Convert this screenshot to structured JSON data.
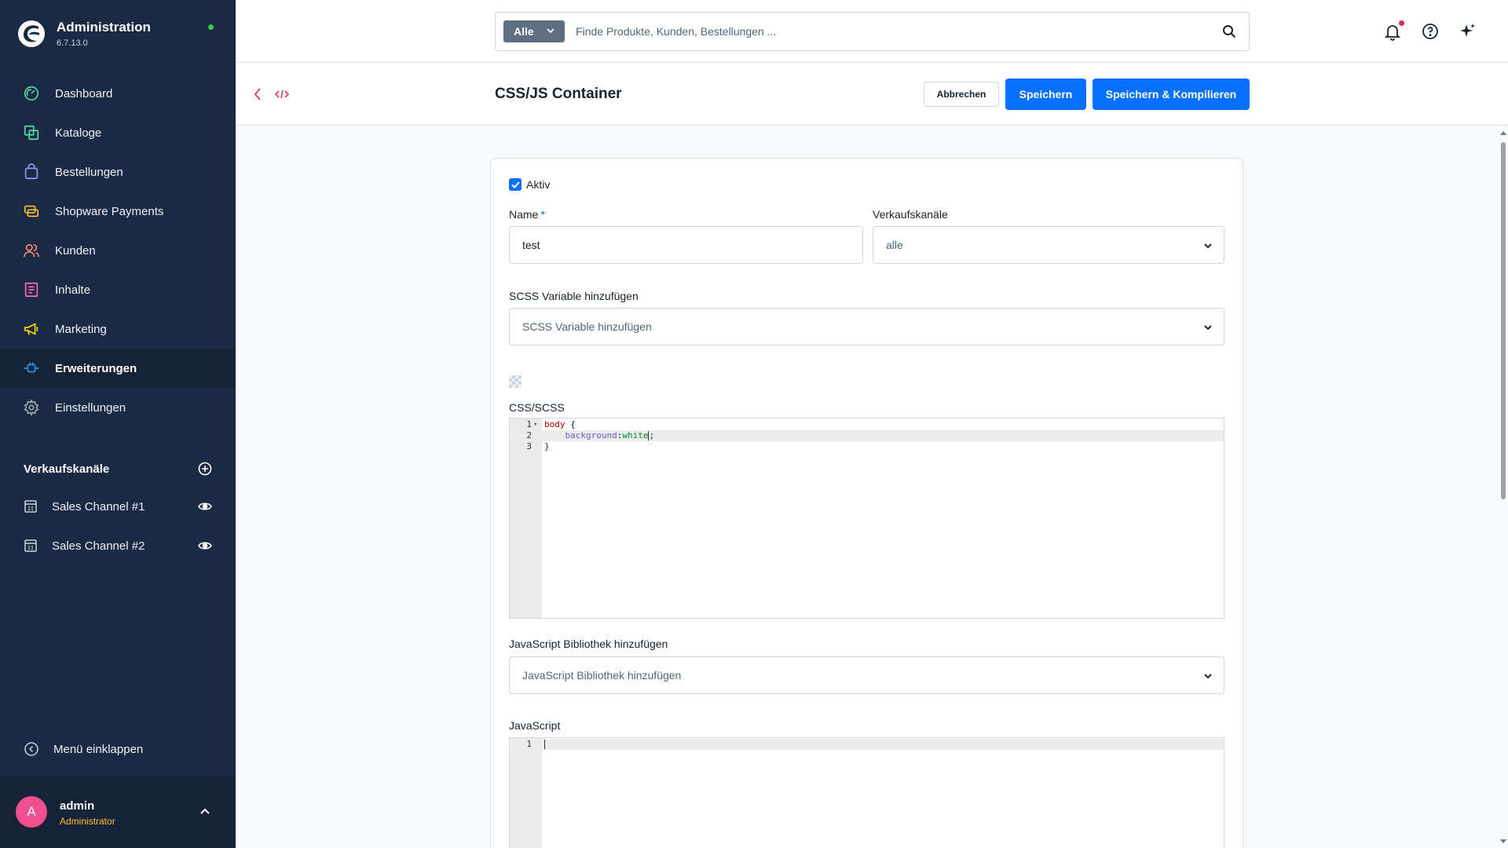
{
  "app": {
    "title": "Administration",
    "version": "6.7.13.0",
    "status_color": "#37d046"
  },
  "sidebar": {
    "items": [
      {
        "label": "Dashboard",
        "icon": "gauge-icon",
        "color": "#57d9a3"
      },
      {
        "label": "Kataloge",
        "icon": "products-icon",
        "color": "#57d9a3"
      },
      {
        "label": "Bestellungen",
        "icon": "shopping-bag-icon",
        "color": "#a092f0"
      },
      {
        "label": "Shopware Payments",
        "icon": "payment-icon",
        "color": "#ffc22c"
      },
      {
        "label": "Kunden",
        "icon": "users-icon",
        "color": "#f88962"
      },
      {
        "label": "Inhalte",
        "icon": "content-icon",
        "color": "#ff68b4"
      },
      {
        "label": "Marketing",
        "icon": "megaphone-icon",
        "color": "#ffd700"
      },
      {
        "label": "Erweiterungen",
        "icon": "plug-icon",
        "color": "#189eff",
        "active": true
      },
      {
        "label": "Einstellungen",
        "icon": "gear-icon",
        "color": "#9aa8b5"
      }
    ],
    "sales_channels_title": "Verkaufskanäle",
    "sales_channels": [
      {
        "label": "Sales Channel #1"
      },
      {
        "label": "Sales Channel #2"
      }
    ],
    "collapse_label": "Menü einklappen",
    "user": {
      "initial": "A",
      "name": "admin",
      "role": "Administrator"
    }
  },
  "topbar": {
    "search_filter": "Alle",
    "search_placeholder": "Finde Produkte, Kunden, Bestellungen ..."
  },
  "smartbar": {
    "title": "CSS/JS Container",
    "cancel_label": "Abbrechen",
    "save_label": "Speichern",
    "compile_label": "Speichern & Kompilieren"
  },
  "form": {
    "active_label": "Aktiv",
    "active_checked": true,
    "name_label": "Name",
    "name_required_mark": "*",
    "name_value": "test",
    "saleschannels_label": "Verkaufskanäle",
    "saleschannels_value": "alle",
    "scss_var_label": "SCSS Variable hinzufügen",
    "scss_var_placeholder": "SCSS Variable hinzufügen",
    "css_label": "CSS/SCSS",
    "css_code": [
      {
        "num": "1",
        "selector": "body",
        "rest": " {"
      },
      {
        "num": "2",
        "property": "background",
        "value": "white"
      },
      {
        "num": "3",
        "rest": "}"
      }
    ],
    "js_lib_label": "JavaScript Bibliothek hinzufügen",
    "js_lib_placeholder": "JavaScript Bibliothek hinzufügen",
    "js_label": "JavaScript",
    "js_code": [
      {
        "num": "1"
      }
    ]
  },
  "colors": {
    "primary": "#0870ff",
    "sidebar_bg": "#1b2a44",
    "avatar": "#f24f90",
    "role": "#ffc22c",
    "notification_dot": "#de294c"
  }
}
